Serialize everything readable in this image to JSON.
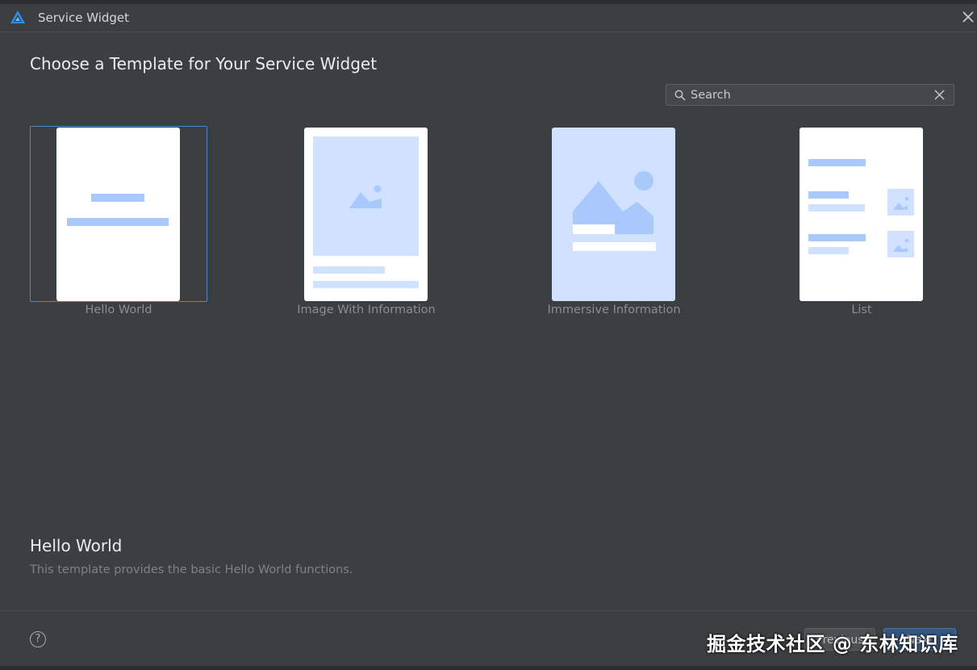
{
  "window": {
    "title": "Service Widget",
    "close_icon": "close-icon"
  },
  "heading": "Choose a Template for Your Service Widget",
  "search": {
    "placeholder": "Search",
    "value": ""
  },
  "templates": [
    {
      "label": "Hello World",
      "selected": true
    },
    {
      "label": "Image With Information",
      "selected": false
    },
    {
      "label": "Immersive Information",
      "selected": false
    },
    {
      "label": "List",
      "selected": false
    }
  ],
  "description": {
    "title": "Hello World",
    "text": "This template provides the basic Hello World functions."
  },
  "footer": {
    "help_label": "?",
    "previous_label": "Previous",
    "next_label": "Next"
  },
  "watermark": "掘金技术社区 @ 东林知识库",
  "colors": {
    "accent_selection": "#4f88c6",
    "preview_blue": "#a9c8fb",
    "preview_light_blue": "#d0e2ff",
    "background": "#3c3f41"
  }
}
